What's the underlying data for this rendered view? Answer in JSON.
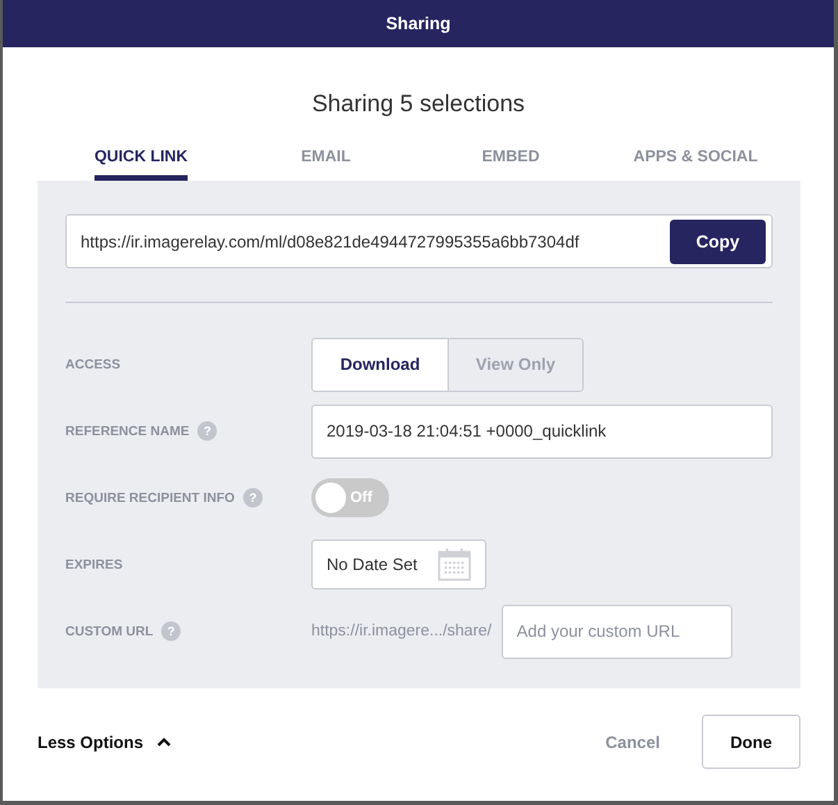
{
  "header": {
    "title": "Sharing"
  },
  "heading": "Sharing 5 selections",
  "tabs": [
    {
      "label": "QUICK LINK",
      "selected": true
    },
    {
      "label": "EMAIL",
      "selected": false
    },
    {
      "label": "EMBED",
      "selected": false
    },
    {
      "label": "APPS & SOCIAL",
      "selected": false
    }
  ],
  "link": {
    "value": "https://ir.imagerelay.com/ml/d08e821de4944727995355a6bb7304df",
    "button": "Copy"
  },
  "options": [
    {
      "kind": "segmented",
      "label": "ACCESS",
      "segments": [
        {
          "label": "Download",
          "selected": true
        },
        {
          "label": "View Only",
          "selected": false
        }
      ]
    },
    {
      "kind": "text",
      "label": "REFERENCE NAME",
      "help": "?",
      "value": "2019-03-18 21:04:51 +0000_quicklink"
    },
    {
      "kind": "toggle",
      "label": "REQUIRE RECIPIENT INFO",
      "help": "?",
      "on": false,
      "state_text": "Off"
    },
    {
      "kind": "date",
      "label": "EXPIRES",
      "value": "No Date Set"
    },
    {
      "kind": "url",
      "label": "CUSTOM URL",
      "help": "?",
      "prefix": "https://ir.imagere.../share/",
      "placeholder": "Add your custom URL"
    }
  ],
  "footer": {
    "toggle_label": "Less Options",
    "expanded": true,
    "cancel": "Cancel",
    "done": "Done"
  }
}
